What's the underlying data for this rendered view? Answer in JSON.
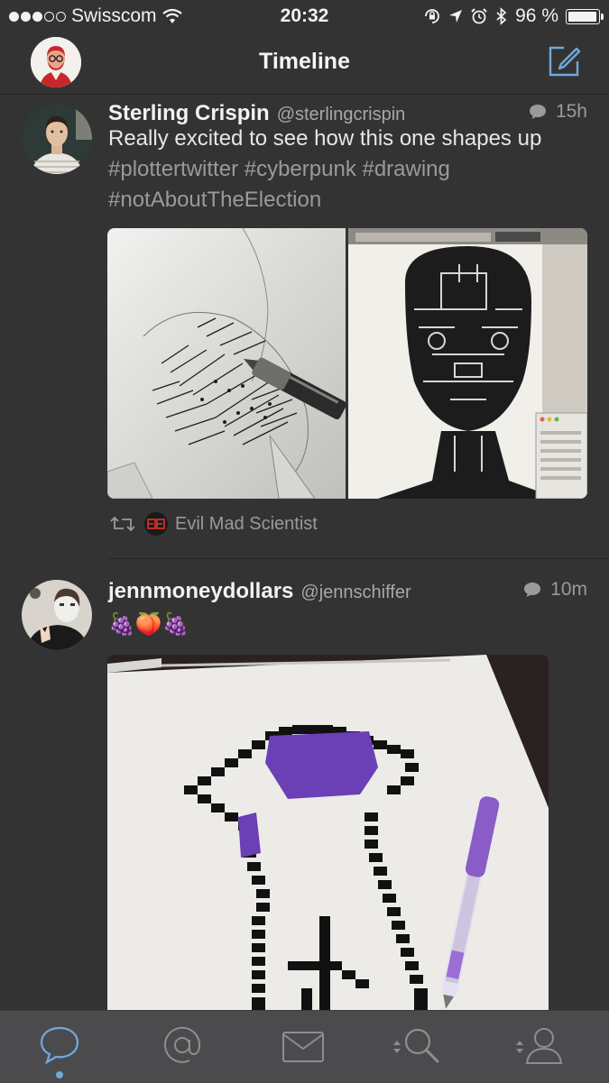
{
  "status_bar": {
    "carrier": "Swisscom",
    "time": "20:32",
    "battery_percent": "96 %",
    "battery_level": 0.96,
    "signal_bars_filled": 3,
    "signal_bars_total": 5
  },
  "nav": {
    "title": "Timeline",
    "avatar_icon": "profile-avatar",
    "compose_icon": "compose-icon"
  },
  "tweets": [
    {
      "display_name": "Sterling Crispin",
      "handle": "@sterlingcrispin",
      "time_ago": "15h",
      "text": "Really excited to see how this one shapes up",
      "hashtags": [
        "#plottertwitter",
        "#cyberpunk",
        "#drawing",
        "#notAboutTheElection"
      ],
      "retweeted_by": "Evil Mad Scientist"
    },
    {
      "display_name": "jennmoneydollars",
      "handle": "@jennschiffer",
      "time_ago": "10m",
      "text": "🍇🍑🍇"
    }
  ],
  "tabs": [
    {
      "name": "timeline",
      "icon": "speech-bubble-icon",
      "active": true
    },
    {
      "name": "mentions",
      "icon": "at-sign-icon",
      "active": false
    },
    {
      "name": "messages",
      "icon": "envelope-icon",
      "active": false
    },
    {
      "name": "search",
      "icon": "search-icon",
      "active": false
    },
    {
      "name": "profile",
      "icon": "person-icon",
      "active": false
    }
  ],
  "colors": {
    "background": "#333334",
    "tab_bar": "#4b4b4d",
    "accent": "#6fa8dc",
    "secondary_text": "#9a9a9a",
    "pixel_art_purple": "#6b3fb5"
  }
}
